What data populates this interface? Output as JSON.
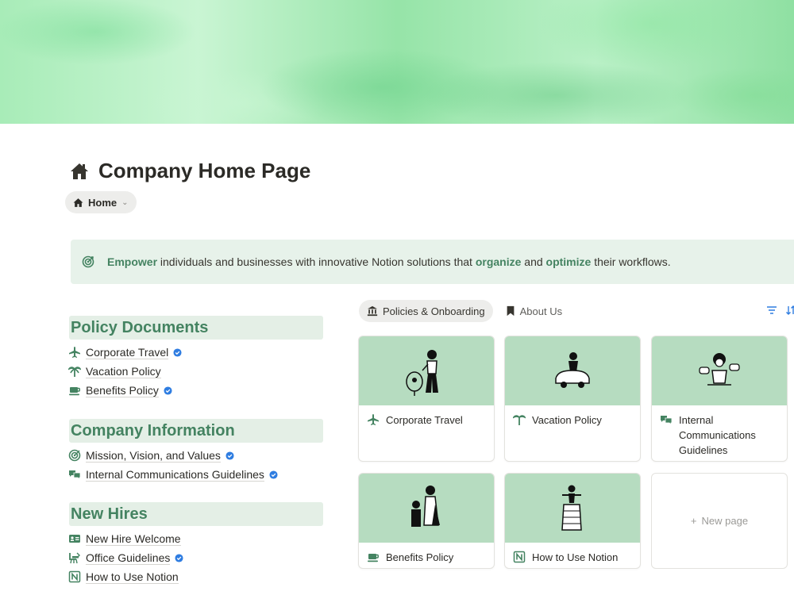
{
  "page": {
    "title": "Company Home Page",
    "breadcrumb": "Home"
  },
  "callout": {
    "parts": [
      {
        "text": "Empower",
        "highlight": true
      },
      {
        "text": " individuals and businesses with innovative Notion solutions that ",
        "highlight": false
      },
      {
        "text": "organize",
        "highlight": true
      },
      {
        "text": " and ",
        "highlight": false
      },
      {
        "text": "optimize",
        "highlight": true
      },
      {
        "text": " their workflows.",
        "highlight": false
      }
    ]
  },
  "sections": [
    {
      "heading": "Policy Documents",
      "items": [
        {
          "label": "Corporate Travel",
          "icon": "airplane-icon",
          "verified": true
        },
        {
          "label": "Vacation Policy",
          "icon": "palm-tree-icon",
          "verified": false
        },
        {
          "label": "Benefits Policy",
          "icon": "coffee-cup-icon",
          "verified": true
        }
      ]
    },
    {
      "heading": "Company Information",
      "items": [
        {
          "label": "Mission, Vision, and Values",
          "icon": "target-icon",
          "verified": true
        },
        {
          "label": "Internal Communications Guidelines",
          "icon": "chat-bubbles-icon",
          "verified": true
        }
      ]
    },
    {
      "heading": "New Hires",
      "items": [
        {
          "label": "New Hire Welcome",
          "icon": "id-card-icon",
          "verified": false
        },
        {
          "label": "Office Guidelines",
          "icon": "office-chair-icon",
          "verified": true
        },
        {
          "label": "How to Use Notion",
          "icon": "notion-logo-icon",
          "verified": false
        }
      ]
    }
  ],
  "tabs": [
    {
      "label": "Policies & Onboarding",
      "icon": "bank-icon",
      "active": true
    },
    {
      "label": "About Us",
      "icon": "bookmark-icon",
      "active": false
    }
  ],
  "toolbar": {
    "icons": [
      "filter-icon",
      "sort-icon"
    ]
  },
  "gallery": {
    "cards": [
      {
        "title": "Corporate Travel",
        "icon": "airplane-icon"
      },
      {
        "title": "Vacation Policy",
        "icon": "palm-tree-icon"
      },
      {
        "title": "Internal Communications Guidelines",
        "icon": "chat-bubbles-icon"
      },
      {
        "title": "Benefits Policy",
        "icon": "coffee-cup-icon"
      },
      {
        "title": "How to Use Notion",
        "icon": "notion-logo-icon"
      }
    ],
    "new_page_label": "New page"
  },
  "colors": {
    "accent_green": "#448361",
    "callout_bg": "#e7f2ea",
    "card_thumb_bg": "#b6dcc0",
    "verified_blue": "#2f7de1"
  }
}
